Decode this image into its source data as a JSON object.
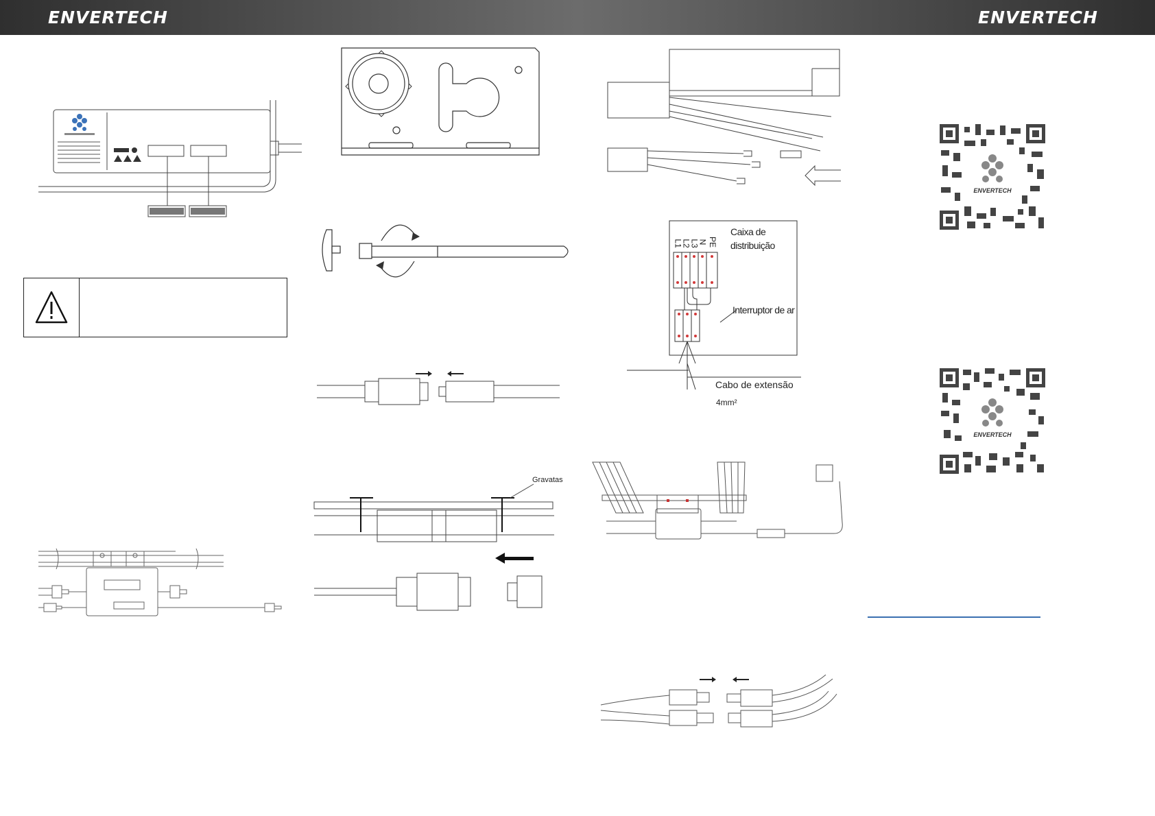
{
  "header": {
    "brand_left": "ENVERTECH",
    "brand_right": "ENVERTECH",
    "bar_color": "#4e4e4e"
  },
  "figures": {
    "mounting_bracket": {},
    "antenna": {},
    "ac_connector": {},
    "cable_ties": {
      "label": "Gravatas"
    },
    "inverter_on_rail": {},
    "cable_prep": {},
    "distribution_box": {
      "title_line1": "Caixa de",
      "title_line2": "distribuição",
      "terminal_labels": [
        "L1",
        "L2",
        "L3",
        "N",
        "PE"
      ],
      "breaker_label": "Interruptor de ar",
      "cable_label": "Cabo de extensão",
      "cable_size": "4mm²"
    },
    "system_layout": {},
    "dc_connector": {}
  },
  "qr_codes": [
    {
      "icon": "qr-code-icon",
      "logo_text": "ENVERTECH"
    },
    {
      "icon": "qr-code-icon",
      "logo_text": "ENVERTECH"
    }
  ],
  "colors": {
    "qr_link_underline": "#3a6fb0",
    "logo_blue": "#3b72b8"
  }
}
